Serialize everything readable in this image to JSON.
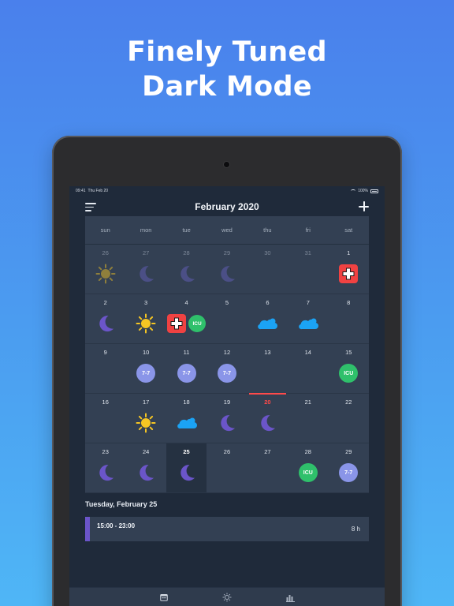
{
  "headline": {
    "line1": "Finely Tuned",
    "line2": "Dark Mode"
  },
  "status_bar": {
    "time": "09:41",
    "date": "Thu Feb 20",
    "battery": "100%"
  },
  "header": {
    "title": "February 2020",
    "menu_icon": "hamburger-menu-icon",
    "add_icon": "plus-icon"
  },
  "weekdays": [
    "sun",
    "mon",
    "tue",
    "wed",
    "thu",
    "fri",
    "sat"
  ],
  "colors": {
    "moon": "#6b55c9",
    "moon_dim": "#4b4f86",
    "sun": "#f7c623",
    "sun_dim": "#8f7f3c",
    "cloud": "#1ba3f5",
    "icu": "#2fc06b",
    "shift_7_7": "#8a95e8",
    "medical": "#f04242",
    "today_marker": "#ff4a4a"
  },
  "days": [
    {
      "day": "26",
      "other": true,
      "icons": [
        {
          "type": "sun",
          "dim": true
        }
      ]
    },
    {
      "day": "27",
      "other": true,
      "icons": [
        {
          "type": "moon",
          "dim": true
        }
      ]
    },
    {
      "day": "28",
      "other": true,
      "icons": [
        {
          "type": "moon",
          "dim": true
        }
      ]
    },
    {
      "day": "29",
      "other": true,
      "icons": [
        {
          "type": "moon",
          "dim": true
        }
      ]
    },
    {
      "day": "30",
      "other": true,
      "icons": []
    },
    {
      "day": "31",
      "other": true,
      "icons": []
    },
    {
      "day": "1",
      "icons": [
        {
          "type": "medical"
        }
      ]
    },
    {
      "day": "2",
      "icons": [
        {
          "type": "moon"
        }
      ]
    },
    {
      "day": "3",
      "icons": [
        {
          "type": "sun"
        }
      ]
    },
    {
      "day": "4",
      "icons": [
        {
          "type": "medical"
        },
        {
          "type": "badge",
          "label": "ICU",
          "color": "icu",
          "small": true
        }
      ]
    },
    {
      "day": "5",
      "icons": []
    },
    {
      "day": "6",
      "icons": [
        {
          "type": "cloud"
        }
      ]
    },
    {
      "day": "7",
      "icons": [
        {
          "type": "cloud"
        }
      ]
    },
    {
      "day": "8",
      "icons": []
    },
    {
      "day": "9",
      "icons": []
    },
    {
      "day": "10",
      "icons": [
        {
          "type": "badge",
          "label": "7-7",
          "color": "shift_7_7"
        }
      ]
    },
    {
      "day": "11",
      "icons": [
        {
          "type": "badge",
          "label": "7-7",
          "color": "shift_7_7"
        }
      ]
    },
    {
      "day": "12",
      "icons": [
        {
          "type": "badge",
          "label": "7-7",
          "color": "shift_7_7"
        }
      ]
    },
    {
      "day": "13",
      "icons": []
    },
    {
      "day": "14",
      "icons": []
    },
    {
      "day": "15",
      "icons": [
        {
          "type": "badge",
          "label": "ICU",
          "color": "icu"
        }
      ]
    },
    {
      "day": "16",
      "icons": []
    },
    {
      "day": "17",
      "icons": [
        {
          "type": "sun"
        }
      ]
    },
    {
      "day": "18",
      "icons": [
        {
          "type": "cloud"
        }
      ]
    },
    {
      "day": "19",
      "icons": [
        {
          "type": "moon"
        }
      ]
    },
    {
      "day": "20",
      "current": true,
      "icons": [
        {
          "type": "moon"
        }
      ]
    },
    {
      "day": "21",
      "icons": []
    },
    {
      "day": "22",
      "icons": []
    },
    {
      "day": "23",
      "icons": [
        {
          "type": "moon"
        }
      ]
    },
    {
      "day": "24",
      "icons": [
        {
          "type": "moon"
        }
      ]
    },
    {
      "day": "25",
      "today": true,
      "icons": [
        {
          "type": "moon"
        }
      ]
    },
    {
      "day": "26",
      "icons": []
    },
    {
      "day": "27",
      "icons": []
    },
    {
      "day": "28",
      "icons": [
        {
          "type": "badge",
          "label": "ICU",
          "color": "icu"
        }
      ]
    },
    {
      "day": "29",
      "icons": [
        {
          "type": "badge",
          "label": "7-7",
          "color": "shift_7_7"
        }
      ]
    }
  ],
  "selected_day": {
    "label": "Tuesday, February 25"
  },
  "event": {
    "time": "15:00 - 23:00",
    "duration": "8 h"
  },
  "tabs": [
    {
      "name": "calendar-icon"
    },
    {
      "name": "sun-settings-icon"
    },
    {
      "name": "stats-icon"
    }
  ]
}
